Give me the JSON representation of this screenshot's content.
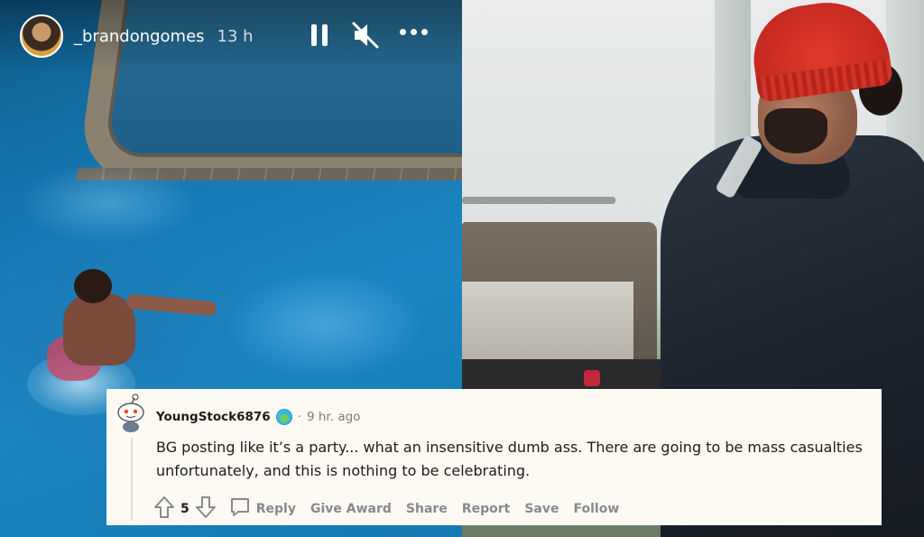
{
  "story": {
    "username": "_brandongomes",
    "time_ago": "13 h",
    "controls": [
      "pause-icon",
      "mute-icon",
      "more-options-icon"
    ]
  },
  "comment": {
    "author": "YoungStock6876",
    "separator": "·",
    "time_ago": "9 hr. ago",
    "body": "BG posting like it’s a party... what an insensitive dumb ass. There are going to be mass casualties unfortunately, and this is nothing to be celebrating.",
    "vote_count": "5",
    "actions": {
      "reply": "Reply",
      "give_award": "Give Award",
      "share": "Share",
      "report": "Report",
      "save": "Save",
      "follow": "Follow"
    },
    "colors": {
      "card_background": "#fdfaf4",
      "meta_text": "#878a8c",
      "body_text": "#1c1c1c"
    }
  }
}
